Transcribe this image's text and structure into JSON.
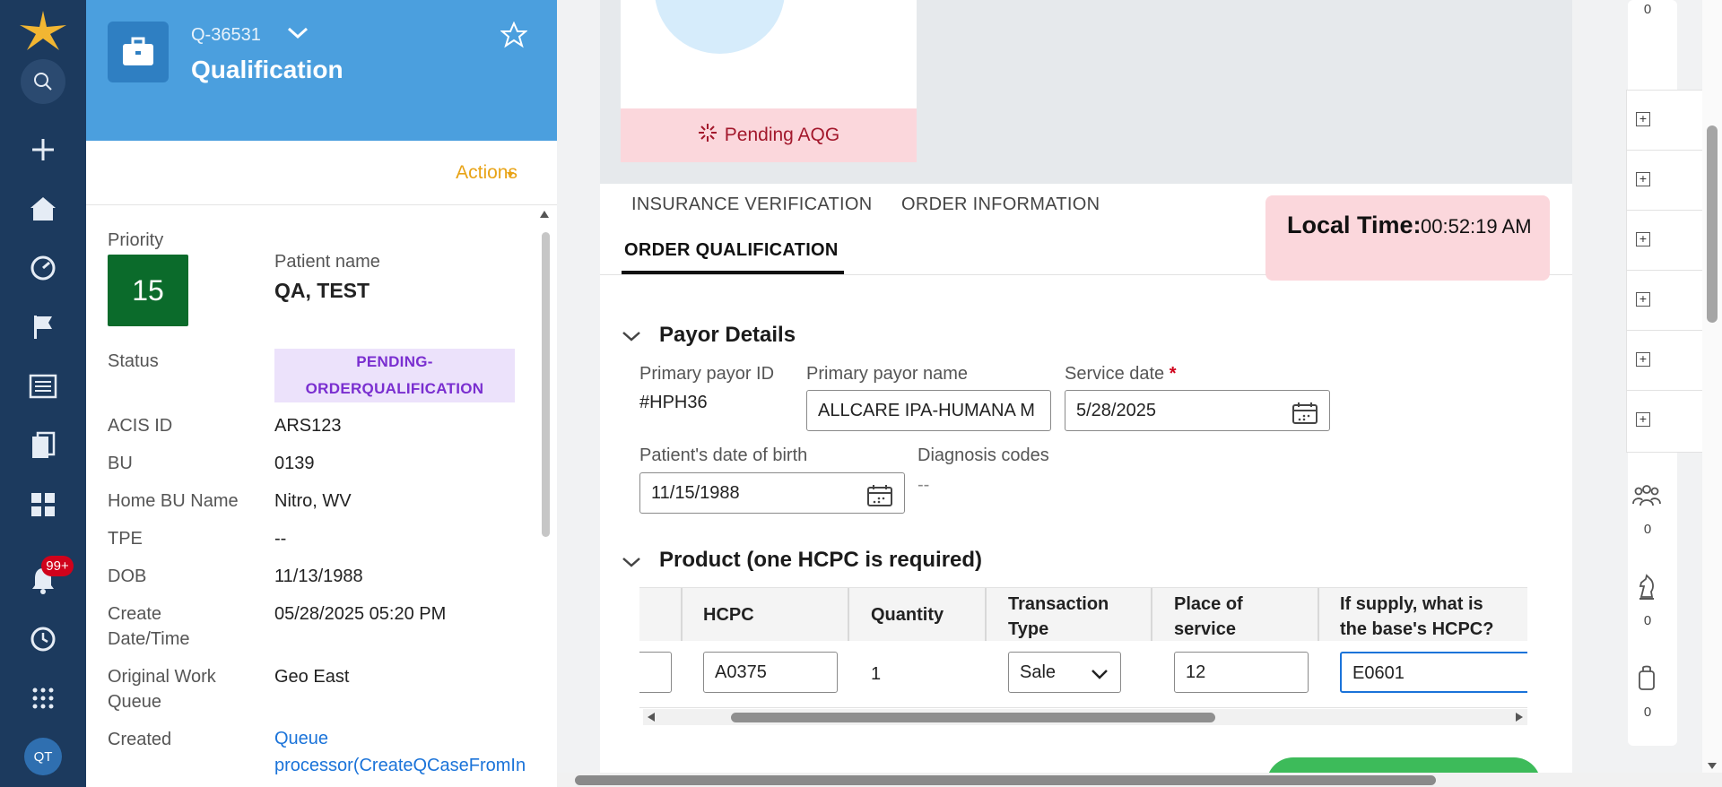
{
  "nav": {
    "items": [
      "search",
      "create",
      "home",
      "dashboard",
      "flag",
      "news",
      "documents",
      "apps",
      "notifications",
      "history",
      "more"
    ],
    "notifications_badge": "99+",
    "avatar_initials": "QT"
  },
  "case": {
    "id": "Q-36531",
    "title": "Qualification",
    "actions_label": "Actions"
  },
  "summary": {
    "priority_label": "Priority",
    "priority_value": "15",
    "patient_name_label": "Patient name",
    "patient_name_value": "QA, TEST",
    "status_label": "Status",
    "status_line1": "PENDING-",
    "status_line2": "ORDERQUALIFICATION",
    "acis_label": "ACIS ID",
    "acis_value": "ARS123",
    "bu_label": "BU",
    "bu_value": "0139",
    "home_bu_label": "Home BU Name",
    "home_bu_value": "Nitro, WV",
    "tpe_label": "TPE",
    "tpe_value": "--",
    "dob_label": "DOB",
    "dob_value": "11/13/1988",
    "create_label_1": "Create",
    "create_label_2": "Date/Time",
    "create_value": "05/28/2025 05:20 PM",
    "owq_label_1": "Original Work",
    "owq_label_2": "Queue",
    "owq_value": "Geo East",
    "created_label": "Created",
    "created_link_1": "Queue",
    "created_link_2": "processor(CreateQCaseFromIn"
  },
  "banner": {
    "pending_label": "Pending AQG"
  },
  "tabs": {
    "insurance": "INSURANCE VERIFICATION",
    "order_info": "ORDER INFORMATION",
    "order_qual": "ORDER QUALIFICATION"
  },
  "local_time": {
    "label": "Local Time:",
    "value": "00:52:19 AM"
  },
  "payor": {
    "section_title": "Payor Details",
    "primary_id_label": "Primary payor ID",
    "primary_id_value": "#HPH36",
    "primary_name_label": "Primary payor name",
    "primary_name_value": "ALLCARE IPA-HUMANA M",
    "service_date_label": "Service date",
    "required_mark": "*",
    "service_date_value": "5/28/2025",
    "dob_label": "Patient's date of birth",
    "dob_value": "11/15/1988",
    "diagnosis_label": "Diagnosis codes",
    "diagnosis_value": "--"
  },
  "product": {
    "section_title": "Product (one HCPC is required)",
    "columns": {
      "hcpc": "HCPC",
      "quantity": "Quantity",
      "transaction_1": "Transaction",
      "transaction_2": "Type",
      "place_1": "Place of",
      "place_2": "service",
      "supply_1": "If supply, what is",
      "supply_2": "the base's HCPC?"
    },
    "row": {
      "hcpc": "A0375",
      "quantity": "1",
      "transaction_type": "Sale",
      "place_of_service": "12",
      "base_hcpc": "E0601"
    }
  },
  "rail": {
    "top_count": "0",
    "team_count": "0",
    "chess_count": "0",
    "bag_count": "0"
  },
  "colors": {
    "nav_bg": "#1c3a5e",
    "header_bg": "#4b9fde",
    "priority_bg": "#0b6b2b",
    "status_bg": "#ece2fb",
    "status_text": "#7a2fd0",
    "alert_bg": "#fbd7dc",
    "actions_text": "#e8a316",
    "link": "#1a73d9"
  }
}
